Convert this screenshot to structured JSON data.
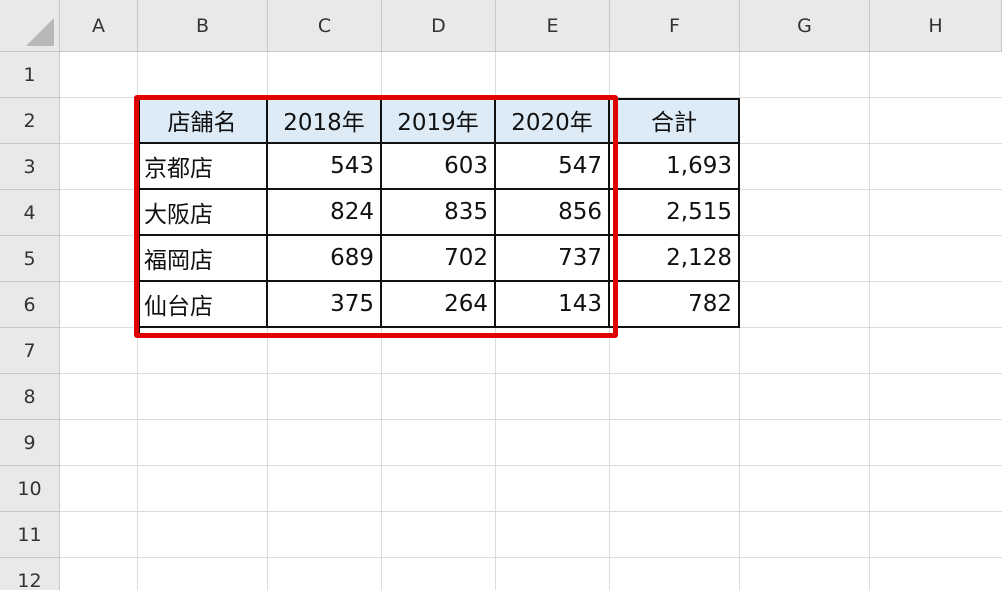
{
  "columns": [
    "A",
    "B",
    "C",
    "D",
    "E",
    "F",
    "G",
    "H"
  ],
  "rows": [
    "1",
    "2",
    "3",
    "4",
    "5",
    "6",
    "7",
    "8",
    "9",
    "10",
    "11",
    "12"
  ],
  "table": {
    "headers": [
      "店舗名",
      "2018年",
      "2019年",
      "2020年",
      "合計"
    ],
    "rows": [
      [
        "京都店",
        "543",
        "603",
        "547",
        "1,693"
      ],
      [
        "大阪店",
        "824",
        "835",
        "856",
        "2,515"
      ],
      [
        "福岡店",
        "689",
        "702",
        "737",
        "2,128"
      ],
      [
        "仙台店",
        "375",
        "264",
        "143",
        "782"
      ]
    ]
  },
  "colors": {
    "header_fill": "#ddebf7",
    "highlight": "#e00000",
    "heading_bg": "#e9e9e9",
    "gridline": "#dcdcdc"
  }
}
